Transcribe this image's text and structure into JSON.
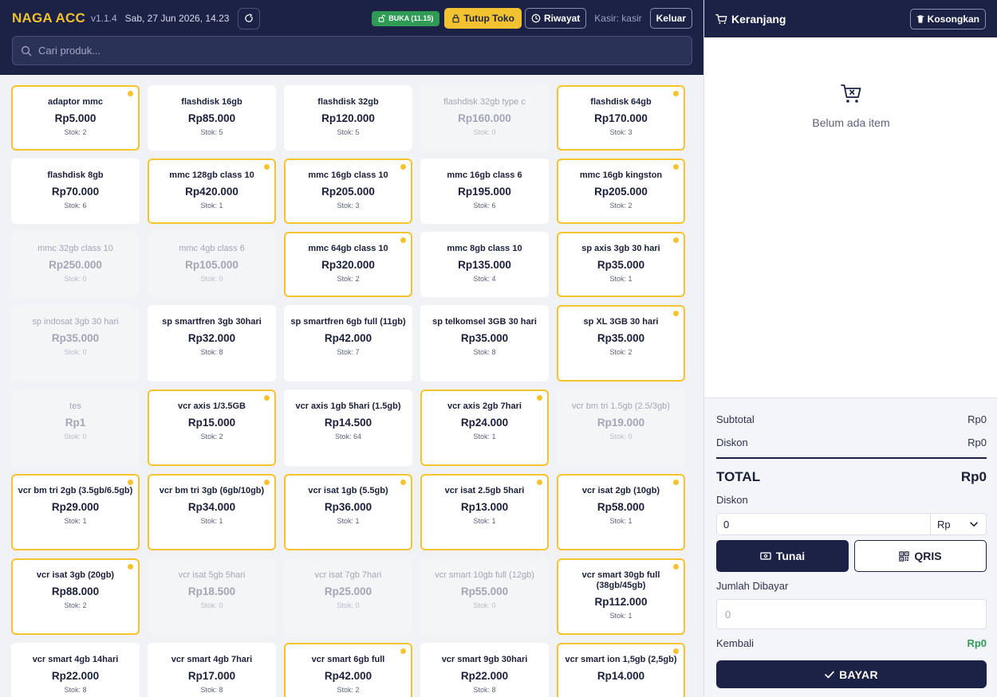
{
  "header": {
    "brand": "NAGA ACC",
    "version": "v1.1.4",
    "datetime": "Sab, 27 Jun 2026, 14.23",
    "open_badge": "BUKA (11.15)",
    "close_store_label": "Tutup Toko",
    "history_label": "Riwayat",
    "cashier": "Kasir: kasir",
    "logout_label": "Keluar"
  },
  "search": {
    "placeholder": "Cari produk...",
    "value": ""
  },
  "products": [
    {
      "name": "adaptor mmc",
      "price": "Rp5.000",
      "stock": "Stok: 2",
      "highlighted": true
    },
    {
      "name": "flashdisk 16gb",
      "price": "Rp85.000",
      "stock": "Stok: 5",
      "highlighted": false
    },
    {
      "name": "flashdisk 32gb",
      "price": "Rp120.000",
      "stock": "Stok: 5",
      "highlighted": false
    },
    {
      "name": "flashdisk 32gb type c",
      "price": "Rp160.000",
      "stock": "Stok: 0",
      "highlighted": false
    },
    {
      "name": "flashdisk 64gb",
      "price": "Rp170.000",
      "stock": "Stok: 3",
      "highlighted": true
    },
    {
      "name": "flashdisk 8gb",
      "price": "Rp70.000",
      "stock": "Stok: 6",
      "highlighted": false
    },
    {
      "name": "mmc 128gb class 10",
      "price": "Rp420.000",
      "stock": "Stok: 1",
      "highlighted": true
    },
    {
      "name": "mmc 16gb class 10",
      "price": "Rp205.000",
      "stock": "Stok: 3",
      "highlighted": true
    },
    {
      "name": "mmc 16gb class 6",
      "price": "Rp195.000",
      "stock": "Stok: 6",
      "highlighted": false
    },
    {
      "name": "mmc 16gb kingston",
      "price": "Rp205.000",
      "stock": "Stok: 2",
      "highlighted": true
    },
    {
      "name": "mmc 32gb class 10",
      "price": "Rp250.000",
      "stock": "Stok: 0",
      "highlighted": false
    },
    {
      "name": "mmc 4gb class 6",
      "price": "Rp105.000",
      "stock": "Stok: 0",
      "highlighted": false
    },
    {
      "name": "mmc 64gb class 10",
      "price": "Rp320.000",
      "stock": "Stok: 2",
      "highlighted": true
    },
    {
      "name": "mmc 8gb class 10",
      "price": "Rp135.000",
      "stock": "Stok: 4",
      "highlighted": false
    },
    {
      "name": "sp axis 3gb 30 hari",
      "price": "Rp35.000",
      "stock": "Stok: 1",
      "highlighted": true
    },
    {
      "name": "sp indosat 3gb 30 hari",
      "price": "Rp35.000",
      "stock": "Stok: 0",
      "highlighted": false
    },
    {
      "name": "sp smartfren 3gb 30hari",
      "price": "Rp32.000",
      "stock": "Stok: 8",
      "highlighted": false
    },
    {
      "name": "sp smartfren 6gb full (11gb)",
      "price": "Rp42.000",
      "stock": "Stok: 7",
      "highlighted": false
    },
    {
      "name": "sp telkomsel 3GB 30 hari",
      "price": "Rp35.000",
      "stock": "Stok: 8",
      "highlighted": false
    },
    {
      "name": "sp XL 3GB 30 hari",
      "price": "Rp35.000",
      "stock": "Stok: 2",
      "highlighted": true
    },
    {
      "name": "tes",
      "price": "Rp1",
      "stock": "Stok: 0",
      "highlighted": false
    },
    {
      "name": "vcr axis 1/3.5GB",
      "price": "Rp15.000",
      "stock": "Stok: 2",
      "highlighted": true
    },
    {
      "name": "vcr axis 1gb 5hari (1.5gb)",
      "price": "Rp14.500",
      "stock": "Stok: 64",
      "highlighted": false
    },
    {
      "name": "vcr axis 2gb 7hari",
      "price": "Rp24.000",
      "stock": "Stok: 1",
      "highlighted": true
    },
    {
      "name": "vcr bm tri 1.5gb (2.5/3gb)",
      "price": "Rp19.000",
      "stock": "Stok: 0",
      "highlighted": false
    },
    {
      "name": "vcr bm tri 2gb (3.5gb/6.5gb)",
      "price": "Rp29.000",
      "stock": "Stok: 1",
      "highlighted": true
    },
    {
      "name": "vcr bm tri 3gb (6gb/10gb)",
      "price": "Rp34.000",
      "stock": "Stok: 1",
      "highlighted": true
    },
    {
      "name": "vcr isat 1gb (5.5gb)",
      "price": "Rp36.000",
      "stock": "Stok: 1",
      "highlighted": true
    },
    {
      "name": "vcr isat 2.5gb 5hari",
      "price": "Rp13.000",
      "stock": "Stok: 1",
      "highlighted": true
    },
    {
      "name": "vcr isat 2gb (10gb)",
      "price": "Rp58.000",
      "stock": "Stok: 1",
      "highlighted": true
    },
    {
      "name": "vcr isat 3gb (20gb)",
      "price": "Rp88.000",
      "stock": "Stok: 2",
      "highlighted": true
    },
    {
      "name": "vcr isat 5gb 5hari",
      "price": "Rp18.500",
      "stock": "Stok: 0",
      "highlighted": false
    },
    {
      "name": "vcr isat 7gb 7hari",
      "price": "Rp25.000",
      "stock": "Stok: 0",
      "highlighted": false
    },
    {
      "name": "vcr smart 10gb full (12gb)",
      "price": "Rp55.000",
      "stock": "Stok: 0",
      "highlighted": false
    },
    {
      "name": "vcr smart 30gb full (38gb/45gb)",
      "price": "Rp112.000",
      "stock": "Stok: 1",
      "highlighted": true
    },
    {
      "name": "vcr smart 4gb 14hari",
      "price": "Rp22.000",
      "stock": "Stok: 8",
      "highlighted": false
    },
    {
      "name": "vcr smart 4gb 7hari",
      "price": "Rp17.000",
      "stock": "Stok: 8",
      "highlighted": false
    },
    {
      "name": "vcr smart 6gb full",
      "price": "Rp42.000",
      "stock": "Stok: 2",
      "highlighted": true
    },
    {
      "name": "vcr smart 9gb 30hari",
      "price": "Rp22.000",
      "stock": "Stok: 8",
      "highlighted": false
    },
    {
      "name": "vcr smart ion 1,5gb (2,5gb)",
      "price": "Rp14.000",
      "stock": "",
      "highlighted": true
    }
  ],
  "cart": {
    "title": "Keranjang",
    "clear_label": "Kosongkan",
    "empty_text": "Belum ada item"
  },
  "checkout": {
    "subtotal_label": "Subtotal",
    "subtotal_value": "Rp0",
    "discount_label": "Diskon",
    "discount_value": "Rp0",
    "total_label": "TOTAL",
    "total_value": "Rp0",
    "discount_input_label": "Diskon",
    "discount_input_value": "0",
    "discount_unit": "Rp",
    "cash_label": "Tunai",
    "qris_label": "QRIS",
    "paid_label": "Jumlah Dibayar",
    "paid_placeholder": "0",
    "change_label": "Kembali",
    "change_value": "Rp0",
    "pay_label": "BAYAR"
  },
  "colors": {
    "navy": "#1c2246",
    "accent_yellow": "#f2c230",
    "open_green": "#2f9b55",
    "change_green": "#2f9b55"
  }
}
